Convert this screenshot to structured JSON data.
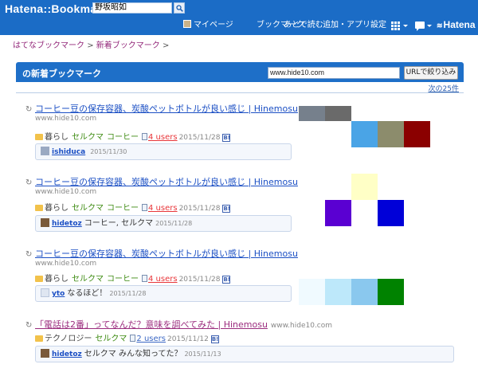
{
  "header": {
    "logo": "Hatena::Bookmark",
    "search_value": "野坂昭如",
    "nav": {
      "mypage": "マイページ",
      "bookmark": "ブックマーク",
      "read_later": "あとで読む",
      "add_apps": "追加・アプリ",
      "settings": "設定"
    },
    "brand": "Hatena"
  },
  "breadcrumb": {
    "root": "はてなブックマーク",
    "current": "新着ブックマーク",
    "sep": ">"
  },
  "panel": {
    "title": "の新着ブックマーク",
    "url_value": "www.hide10.com",
    "filter_button": "URLで絞り込み",
    "next_link": "次の25件"
  },
  "entries": [
    {
      "title": "コーヒー豆の保存容器、炭酸ペットボトルが良い感じ | Hinemosu",
      "domain": "www.hide10.com",
      "tags": [
        "暮らし",
        "セルクマ",
        "コーヒー"
      ],
      "users": "4 users",
      "date": "2015/11/28",
      "comment": {
        "user": "ishiduca",
        "text": "",
        "date": "2015/11/30"
      }
    },
    {
      "title": "コーヒー豆の保存容器、炭酸ペットボトルが良い感じ | Hinemosu",
      "domain": "www.hide10.com",
      "tags": [
        "暮らし",
        "セルクマ",
        "コーヒー"
      ],
      "users": "4 users",
      "date": "2015/11/28",
      "comment": {
        "user": "hidetoz",
        "text": "コーヒー, セルクマ",
        "date": "2015/11/28"
      }
    },
    {
      "title": "コーヒー豆の保存容器、炭酸ペットボトルが良い感じ | Hinemosu",
      "domain": "www.hide10.com",
      "tags": [
        "暮らし",
        "セルクマ",
        "コーヒー"
      ],
      "users": "4 users",
      "date": "2015/11/28",
      "comment": {
        "user": "yto",
        "text": "なるほど！",
        "date": "2015/11/28"
      }
    },
    {
      "title": "「電話は2番」ってなんだ？意味を調べてみた | Hinemosu",
      "domain": "www.hide10.com",
      "tags": [
        "テクノロジー",
        "セルクマ"
      ],
      "users": "2 users",
      "date": "2015/11/12",
      "comment": {
        "user": "hidetoz",
        "text": "セルクマ みんな知ってた？",
        "date": "2015/11/13"
      }
    }
  ],
  "swatch_colors": {
    "g1": [
      "#76808c",
      "#6a6a6a",
      "#4aa4e6",
      "#8c8c6c",
      "#8b0000"
    ],
    "g2": [
      "#ffffc6",
      "#5a00d2",
      "#0000d8"
    ],
    "g3": [
      "#f0faff",
      "#bde8fa",
      "#8ac8ee",
      "#008200"
    ]
  }
}
